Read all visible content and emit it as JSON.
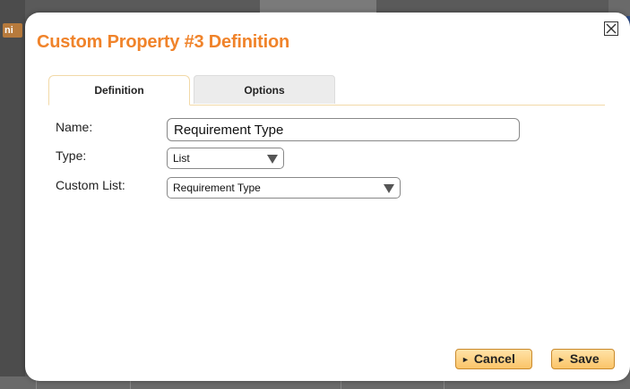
{
  "backdrop": {
    "left_tab_text": "ni"
  },
  "dialog": {
    "title": "Custom Property #3 Definition",
    "close_label": "×"
  },
  "tabs": [
    {
      "label": "Definition",
      "active": true
    },
    {
      "label": "Options",
      "active": false
    }
  ],
  "form": {
    "name": {
      "label": "Name:",
      "value": "Requirement Type"
    },
    "type": {
      "label": "Type:",
      "selected": "List"
    },
    "custom_list": {
      "label": "Custom List:",
      "selected": "Requirement Type"
    }
  },
  "buttons": {
    "cancel_label": "Cancel",
    "save_label": "Save",
    "play_glyph": "►"
  },
  "colors": {
    "title_orange": "#f0832a",
    "button_fill": "#fbc468",
    "button_border": "#c98a2c",
    "tab_border": "#f2d9a8"
  }
}
